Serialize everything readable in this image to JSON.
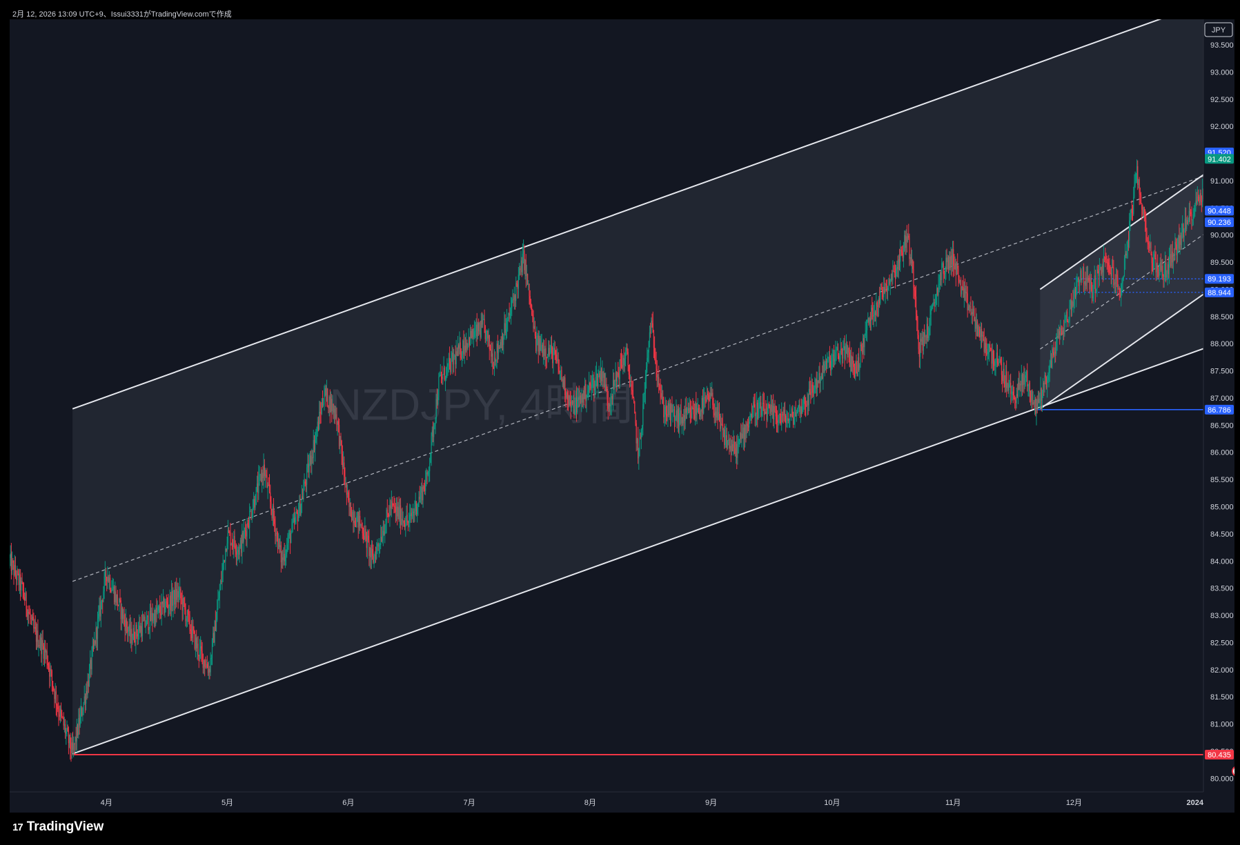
{
  "header": {
    "caption": "2月 12, 2026 13:09 UTC+9、Issui3331がTradingView.comで作成"
  },
  "brand": {
    "mark": "17",
    "name": "TradingView"
  },
  "chart_data": {
    "type": "candlestick",
    "watermark": "NZDJPY, 4時間",
    "currency_button": "JPY",
    "y_ticks": [
      "80.000",
      "80.500",
      "81.000",
      "81.500",
      "82.000",
      "82.500",
      "83.000",
      "83.500",
      "84.000",
      "84.500",
      "85.000",
      "85.500",
      "86.000",
      "86.500",
      "87.000",
      "87.500",
      "88.000",
      "88.500",
      "89.000",
      "89.500",
      "90.000",
      "90.500",
      "91.000",
      "91.500",
      "92.000",
      "92.500",
      "93.000",
      "93.500"
    ],
    "ylim": [
      79.75,
      93.97
    ],
    "x_ticks": [
      {
        "label": "4月",
        "x": 4.0
      },
      {
        "label": "5月",
        "x": 5.0
      },
      {
        "label": "6月",
        "x": 6.0
      },
      {
        "label": "7月",
        "x": 7.0
      },
      {
        "label": "8月",
        "x": 8.0
      },
      {
        "label": "9月",
        "x": 9.0
      },
      {
        "label": "10月",
        "x": 10.0
      },
      {
        "label": "11月",
        "x": 11.0
      },
      {
        "label": "12月",
        "x": 12.0
      },
      {
        "label": "2024",
        "x": 13.0
      }
    ],
    "xlim": [
      3.2,
      13.07
    ],
    "price_labels": [
      {
        "value": 91.52,
        "text": "91.520",
        "color": "#2962ff"
      },
      {
        "value": 91.402,
        "text": "91.402",
        "color": "#089981"
      },
      {
        "value": 90.448,
        "text": "90.448",
        "color": "#2962ff"
      },
      {
        "value": 90.236,
        "text": "90.236",
        "color": "#2962ff"
      },
      {
        "value": 89.193,
        "text": "89.193",
        "color": "#2962ff"
      },
      {
        "value": 88.944,
        "text": "88.944",
        "color": "#2962ff"
      },
      {
        "value": 86.786,
        "text": "86.786",
        "color": "#2962ff"
      },
      {
        "value": 80.435,
        "text": "80.435",
        "color": "#f23645"
      }
    ],
    "path": [
      [
        3.2,
        84.0
      ],
      [
        3.3,
        83.5
      ],
      [
        3.4,
        82.7
      ],
      [
        3.5,
        82.3
      ],
      [
        3.6,
        81.3
      ],
      [
        3.72,
        80.45
      ],
      [
        3.85,
        81.8
      ],
      [
        4.0,
        83.8
      ],
      [
        4.2,
        82.6
      ],
      [
        4.4,
        83.0
      ],
      [
        4.6,
        83.4
      ],
      [
        4.75,
        82.4
      ],
      [
        4.85,
        82.0
      ],
      [
        5.0,
        84.5
      ],
      [
        5.1,
        84.2
      ],
      [
        5.3,
        85.7
      ],
      [
        5.45,
        84.0
      ],
      [
        5.6,
        85.0
      ],
      [
        5.75,
        86.5
      ],
      [
        5.8,
        87.1
      ],
      [
        5.9,
        86.7
      ],
      [
        6.0,
        85.0
      ],
      [
        6.12,
        84.6
      ],
      [
        6.2,
        84.0
      ],
      [
        6.35,
        85.0
      ],
      [
        6.5,
        84.7
      ],
      [
        6.65,
        85.5
      ],
      [
        6.75,
        87.3
      ],
      [
        6.9,
        87.8
      ],
      [
        7.0,
        88.1
      ],
      [
        7.12,
        88.3
      ],
      [
        7.2,
        87.7
      ],
      [
        7.32,
        88.4
      ],
      [
        7.45,
        89.6
      ],
      [
        7.55,
        88.0
      ],
      [
        7.7,
        87.8
      ],
      [
        7.85,
        86.8
      ],
      [
        8.0,
        87.2
      ],
      [
        8.1,
        87.5
      ],
      [
        8.15,
        86.9
      ],
      [
        8.25,
        87.6
      ],
      [
        8.3,
        87.8
      ],
      [
        8.35,
        87.0
      ],
      [
        8.4,
        85.9
      ],
      [
        8.5,
        88.4
      ],
      [
        8.6,
        86.8
      ],
      [
        8.75,
        86.6
      ],
      [
        8.9,
        86.8
      ],
      [
        9.0,
        87.0
      ],
      [
        9.1,
        86.3
      ],
      [
        9.2,
        86.0
      ],
      [
        9.35,
        86.8
      ],
      [
        9.5,
        86.7
      ],
      [
        9.65,
        86.6
      ],
      [
        9.8,
        87.0
      ],
      [
        9.95,
        87.6
      ],
      [
        10.1,
        87.9
      ],
      [
        10.2,
        87.5
      ],
      [
        10.3,
        88.4
      ],
      [
        10.4,
        88.9
      ],
      [
        10.55,
        89.5
      ],
      [
        10.62,
        90.0
      ],
      [
        10.68,
        89.1
      ],
      [
        10.72,
        87.9
      ],
      [
        10.8,
        88.3
      ],
      [
        10.9,
        89.3
      ],
      [
        11.0,
        89.6
      ],
      [
        11.08,
        88.9
      ],
      [
        11.15,
        88.6
      ],
      [
        11.25,
        88.0
      ],
      [
        11.38,
        87.6
      ],
      [
        11.5,
        87.0
      ],
      [
        11.6,
        87.4
      ],
      [
        11.68,
        86.8
      ],
      [
        11.78,
        87.4
      ],
      [
        11.85,
        88.0
      ],
      [
        11.95,
        88.5
      ],
      [
        12.05,
        89.3
      ],
      [
        12.15,
        89.0
      ],
      [
        12.25,
        89.5
      ],
      [
        12.32,
        89.3
      ],
      [
        12.38,
        88.9
      ],
      [
        12.45,
        90.0
      ],
      [
        12.52,
        91.1
      ],
      [
        12.58,
        90.3
      ],
      [
        12.65,
        89.5
      ],
      [
        12.75,
        89.3
      ],
      [
        12.85,
        89.8
      ],
      [
        12.95,
        90.3
      ],
      [
        13.05,
        90.8
      ],
      [
        13.12,
        90.5
      ],
      [
        13.2,
        90.9
      ],
      [
        13.28,
        91.3
      ],
      [
        13.35,
        91.0
      ]
    ],
    "annotations": {
      "big_channel": {
        "p1": [
          3.72,
          80.45
        ],
        "p2": [
          11.68,
          86.8
        ],
        "offset": 6.35
      },
      "small_channel": {
        "p1": [
          11.72,
          86.8
        ],
        "p2": [
          13.0,
          88.8
        ],
        "offset": 2.2
      },
      "markers": [
        {
          "shape": "x",
          "x": 13.46,
          "y": 90.39,
          "color": "#2962ff"
        },
        {
          "shape": "diamond",
          "x": 13.46,
          "y": 91.0,
          "color": "#2962ff"
        }
      ],
      "event_dots": [
        13.35,
        13.58,
        13.65,
        13.73
      ]
    }
  }
}
